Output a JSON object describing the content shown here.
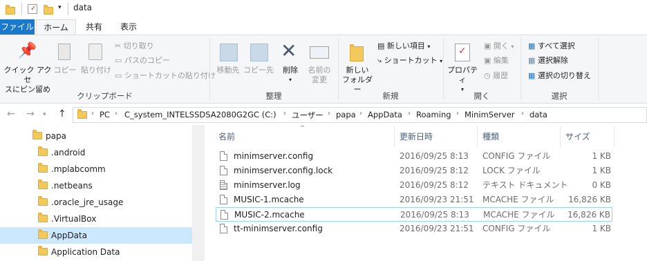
{
  "window": {
    "title": "data"
  },
  "tabs": [
    "ファイル",
    "ホーム",
    "共有",
    "表示"
  ],
  "ribbon": {
    "clipboard": {
      "pin_label_1": "クイック アクセ",
      "pin_label_2": "スにピン留め",
      "copy": "コピー",
      "paste": "貼り付け",
      "cut": "切り取り",
      "copy_path": "パスのコピー",
      "paste_shortcut": "ショートカットの貼り付け",
      "group": "クリップボード"
    },
    "organize": {
      "move_to": "移動先",
      "copy_to": "コピー先",
      "delete": "削除",
      "rename_1": "名前の",
      "rename_2": "変更",
      "group": "整理"
    },
    "new": {
      "new_folder_1": "新しい",
      "new_folder_2": "フォルダー",
      "new_item": "新しい項目",
      "shortcut": "ショートカット",
      "group": "新規"
    },
    "open": {
      "properties": "プロパティ",
      "open": "開く",
      "edit": "編集",
      "history": "履歴",
      "group": "開く"
    },
    "select": {
      "select_all": "すべて選択",
      "select_none": "選択解除",
      "invert": "選択の切り替え",
      "group": "選択"
    }
  },
  "address": {
    "crumbs": [
      "PC",
      "C_system_INTELSSDSA2080G2GC (C:)",
      "ユーザー",
      "papa",
      "AppData",
      "Roaming",
      "MinimServer",
      "data"
    ]
  },
  "navpane": {
    "items": [
      {
        "label": "papa",
        "selected": false
      },
      {
        "label": ".android",
        "selected": false
      },
      {
        "label": ".mplabcomm",
        "selected": false
      },
      {
        "label": ".netbeans",
        "selected": false
      },
      {
        "label": ".oracle_jre_usage",
        "selected": false
      },
      {
        "label": ".VirtualBox",
        "selected": false
      },
      {
        "label": "AppData",
        "selected": true
      },
      {
        "label": "Application Data",
        "selected": false
      }
    ]
  },
  "filelist": {
    "headers": {
      "name": "名前",
      "date": "更新日時",
      "type": "種類",
      "size": "サイズ"
    },
    "rows": [
      {
        "name": "minimserver.config",
        "date": "2016/09/25 8:13",
        "type": "CONFIG ファイル",
        "size": "1 KB"
      },
      {
        "name": "minimserver.config.lock",
        "date": "2016/09/25 8:12",
        "type": "LOCK ファイル",
        "size": "1 KB"
      },
      {
        "name": "minimserver.log",
        "date": "2016/09/25 8:12",
        "type": "テキスト ドキュメント",
        "size": "0 KB"
      },
      {
        "name": "MUSIC-1.mcache",
        "date": "2016/09/23 21:51",
        "type": "MCACHE ファイル",
        "size": "16,826 KB"
      },
      {
        "name": "MUSIC-2.mcache",
        "date": "2016/09/25 8:13",
        "type": "MCACHE ファイル",
        "size": "16,826 KB"
      },
      {
        "name": "tt-minimserver.config",
        "date": "2016/09/23 21:51",
        "type": "CONFIG ファイル",
        "size": "1 KB"
      }
    ]
  },
  "colors": {
    "accent": "#1979ca",
    "selection": "#cce8ff",
    "folder": "#f4c95c"
  }
}
